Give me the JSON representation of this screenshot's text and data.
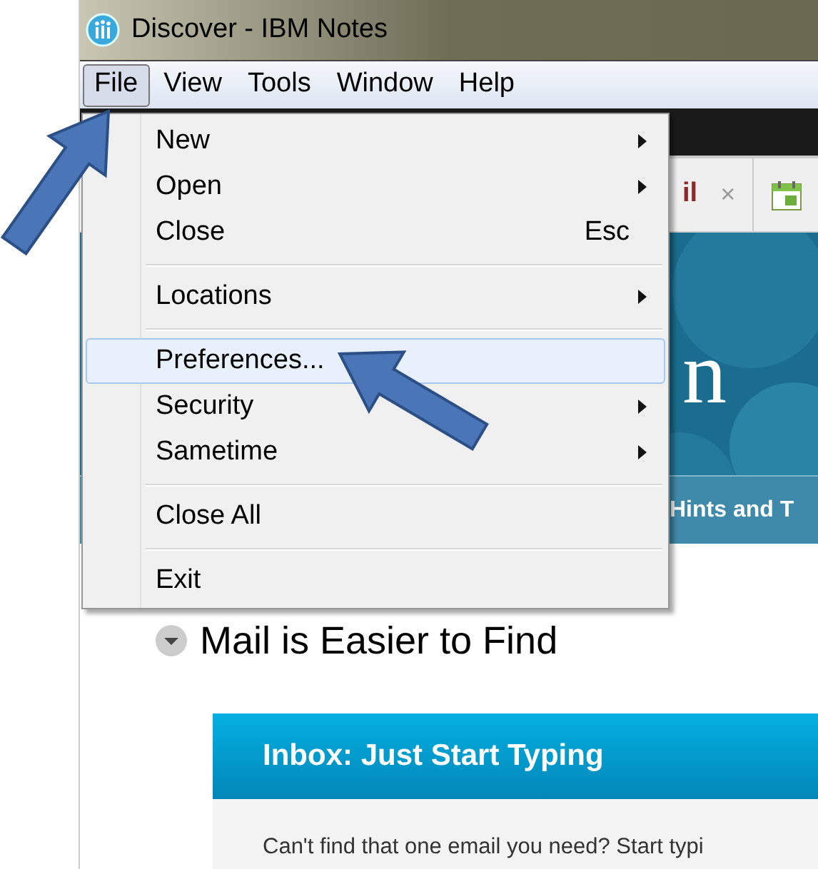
{
  "window": {
    "title": "Discover - IBM Notes"
  },
  "menu_bar": [
    {
      "label": "File",
      "selected": true
    },
    {
      "label": "View",
      "selected": false
    },
    {
      "label": "Tools",
      "selected": false
    },
    {
      "label": "Window",
      "selected": false
    },
    {
      "label": "Help",
      "selected": false
    }
  ],
  "file_menu": [
    {
      "kind": "item",
      "label": "New",
      "submenu": true,
      "selected": false
    },
    {
      "kind": "item",
      "label": "Open",
      "submenu": true,
      "selected": false
    },
    {
      "kind": "item",
      "label": "Close",
      "shortcut": "Esc",
      "submenu": false,
      "selected": false
    },
    {
      "kind": "separator"
    },
    {
      "kind": "item",
      "label": "Locations",
      "submenu": true,
      "selected": false
    },
    {
      "kind": "separator"
    },
    {
      "kind": "item",
      "label": "Preferences...",
      "submenu": false,
      "selected": true
    },
    {
      "kind": "item",
      "label": "Security",
      "submenu": true,
      "selected": false
    },
    {
      "kind": "item",
      "label": "Sametime",
      "submenu": true,
      "selected": false
    },
    {
      "kind": "separator"
    },
    {
      "kind": "item",
      "label": "Close All",
      "submenu": false,
      "selected": false
    },
    {
      "kind": "separator"
    },
    {
      "kind": "item",
      "label": "Exit",
      "submenu": false,
      "selected": false
    }
  ],
  "tabs": [
    {
      "label": "il",
      "close": "×"
    }
  ],
  "banner": {
    "title": "n"
  },
  "nav_strip": {
    "label": "Hints and T"
  },
  "content": {
    "heading": "Mail is Easier to Find",
    "card_title": "Inbox: Just Start Typing",
    "card_text": "Can't find that one email you need? Start typi"
  }
}
